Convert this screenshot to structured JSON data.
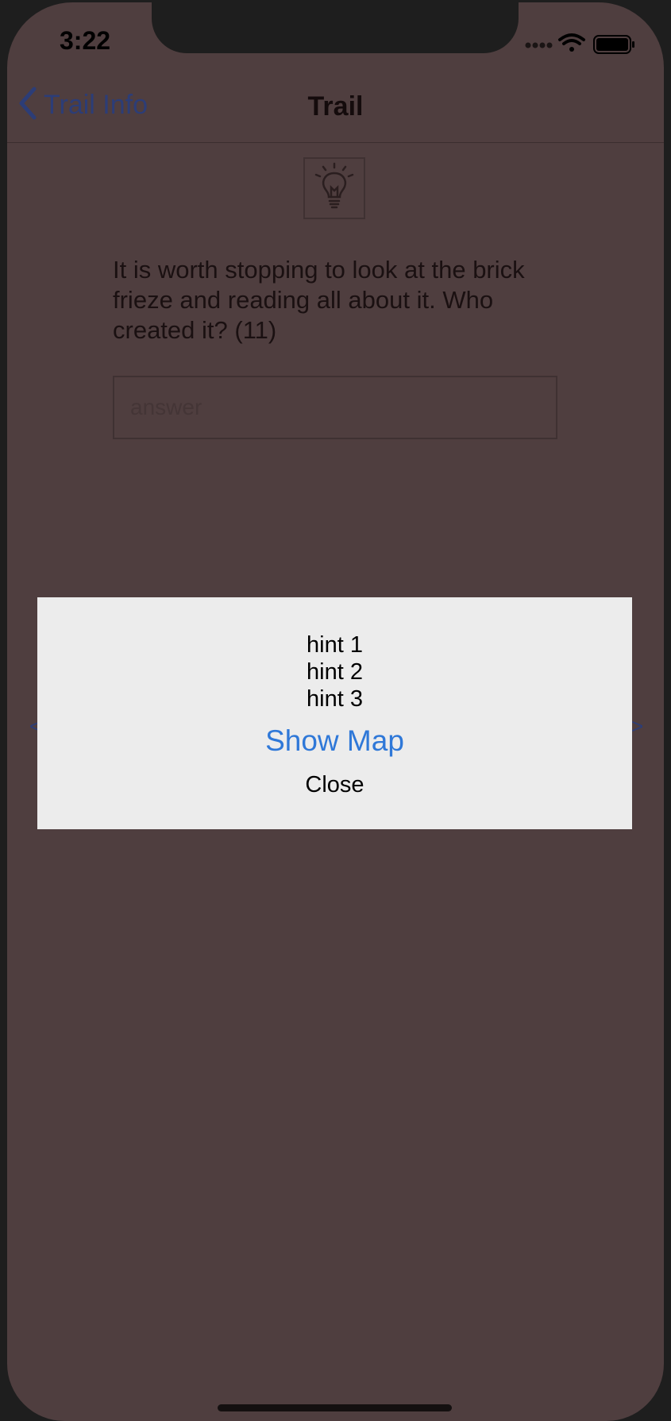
{
  "status_bar": {
    "time": "3:22",
    "icons": [
      "signal-dots-icon",
      "wifi-icon",
      "battery-icon"
    ]
  },
  "navbar": {
    "back_label": "Trail Info",
    "back_icon": "chevron-left-icon",
    "title": "Trail"
  },
  "content": {
    "icon": "lightbulb-icon",
    "question": "It is worth stopping to look at the brick frieze and reading all about it. Who created it? (11)",
    "answer_placeholder": "answer",
    "prev_glyph": "<",
    "next_glyph": ">"
  },
  "modal": {
    "hints": [
      "hint 1",
      "hint 2",
      "hint 3"
    ],
    "show_map_label": "Show Map",
    "close_label": "Close"
  },
  "colors": {
    "overlay": "#4f3e3f",
    "modal_bg": "#ececec",
    "link_blue": "#2f78d8",
    "nav_blue": "#2c3d77"
  }
}
